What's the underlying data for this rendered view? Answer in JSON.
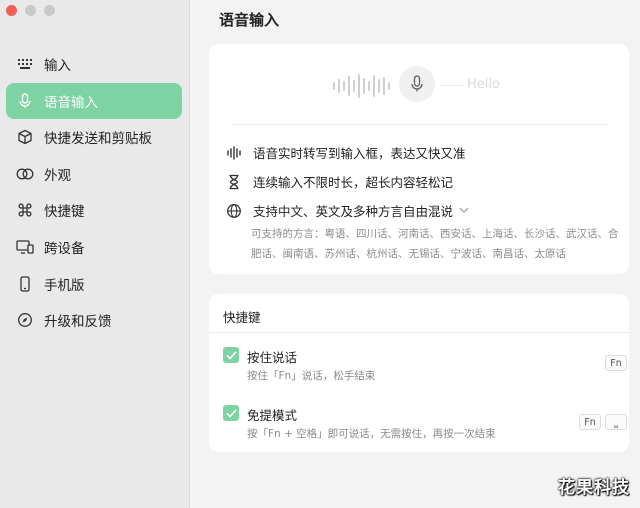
{
  "sidebar": {
    "items": [
      {
        "label": "输入",
        "icon": "keyboard-icon",
        "active": false
      },
      {
        "label": "语音输入",
        "icon": "microphone-icon",
        "active": true
      },
      {
        "label": "快捷发送和剪贴板",
        "icon": "cube-icon",
        "active": false
      },
      {
        "label": "外观",
        "icon": "overlapping-circles-icon",
        "active": false
      },
      {
        "label": "快捷键",
        "icon": "command-icon",
        "active": false
      },
      {
        "label": "跨设备",
        "icon": "devices-icon",
        "active": false
      },
      {
        "label": "手机版",
        "icon": "phone-icon",
        "active": false
      },
      {
        "label": "升级和反馈",
        "icon": "compass-icon",
        "active": false
      }
    ]
  },
  "main": {
    "title": "语音输入",
    "voice_demo": {
      "hello_text": "Hello"
    },
    "features": [
      {
        "icon": "waveform-icon",
        "text": "语音实时转写到输入框，表达又快又准"
      },
      {
        "icon": "hourglass-icon",
        "text": "连续输入不限时长，超长内容轻松记"
      },
      {
        "icon": "globe-icon",
        "text": "支持中文、英文及多种方言自由混说"
      }
    ],
    "dialects_text": "可支持的方言：粤语、四川话、河南话、西安话、上海话、长沙话、武汉话、合肥话、闽南语、苏州话、杭州话、无锡话、宁波话、南昌话、太原话",
    "shortcuts": {
      "title": "快捷键",
      "options": [
        {
          "title": "按住说话",
          "desc": "按住「Fn」说话，松手结束",
          "keys": [
            "Fn"
          ],
          "checked": true
        },
        {
          "title": "免提模式",
          "desc": "按「Fn + 空格」即可说话，无需按住，再按一次结束",
          "keys": [
            "Fn",
            "⎵"
          ],
          "checked": true
        }
      ]
    }
  },
  "watermark": "花果科技",
  "colors": {
    "accent": "#7dd3a2",
    "close_button": "#ee5e57"
  }
}
